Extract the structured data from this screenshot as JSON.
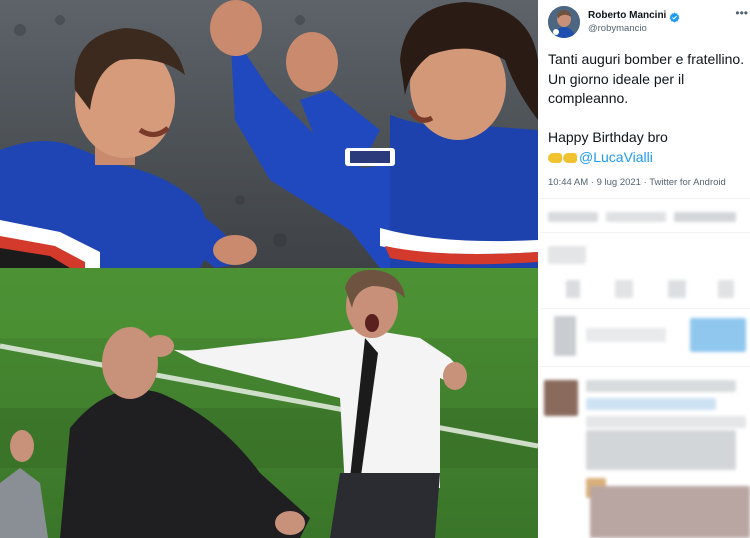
{
  "tweet": {
    "display_name": "Roberto Mancini",
    "handle": "@robymancio",
    "text_line1": "Tanti auguri bomber e fratellino. Un giorno ideale per il compleanno.",
    "text_line2": "Happy Birthday bro",
    "mention": "@LucaVialli",
    "emoji": "clapping-hands-emoji",
    "time": "10:44 AM",
    "date": "9 lug 2021",
    "source": "Twitter for Android",
    "meta_separator": "·",
    "more_icon": "more-horizontal-icon",
    "verified_icon": "verified-badge-icon"
  },
  "colors": {
    "accent": "#1d9bf0",
    "text_primary": "#0f1419",
    "text_secondary": "#536471",
    "sampdoria_blue": "#1f45b5",
    "pitch_green": "#3e7d2c"
  },
  "photos": {
    "top": "photo-celebration-1980s",
    "bottom": "photo-celebration-2021"
  }
}
